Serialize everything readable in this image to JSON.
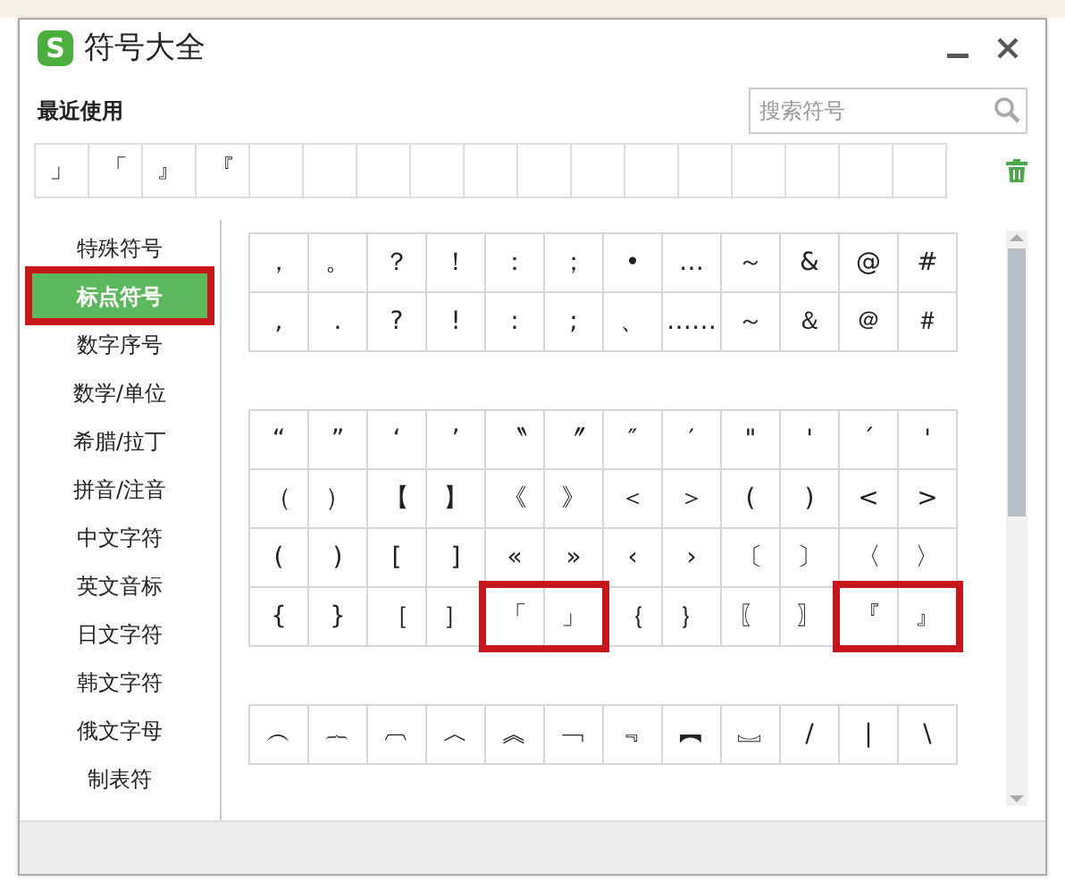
{
  "window": {
    "logo": "S",
    "title": "符号大全"
  },
  "recent": {
    "label": "最近使用",
    "symbols": [
      "」",
      "「",
      "』",
      "『"
    ]
  },
  "search": {
    "placeholder": "搜索符号"
  },
  "sidebar": {
    "items": [
      {
        "label": "特殊符号",
        "selected": false,
        "marked": false
      },
      {
        "label": "标点符号",
        "selected": true,
        "marked": true
      },
      {
        "label": "数字序号",
        "selected": false,
        "marked": false
      },
      {
        "label": "数学/单位",
        "selected": false,
        "marked": false
      },
      {
        "label": "希腊/拉丁",
        "selected": false,
        "marked": false
      },
      {
        "label": "拼音/注音",
        "selected": false,
        "marked": false
      },
      {
        "label": "中文字符",
        "selected": false,
        "marked": false
      },
      {
        "label": "英文音标",
        "selected": false,
        "marked": false
      },
      {
        "label": "日文字符",
        "selected": false,
        "marked": false
      },
      {
        "label": "韩文字符",
        "selected": false,
        "marked": false
      },
      {
        "label": "俄文字母",
        "selected": false,
        "marked": false
      },
      {
        "label": "制表符",
        "selected": false,
        "marked": false
      }
    ]
  },
  "groups": [
    {
      "rows": [
        {
          "cells": [
            "，",
            "。",
            "？",
            "！",
            "：",
            "；",
            "•",
            "…",
            "～",
            "&",
            "@",
            "#"
          ],
          "marked": [
            false,
            false,
            false,
            false,
            false,
            false,
            false,
            false,
            false,
            false,
            false,
            false
          ]
        },
        {
          "cells": [
            ",",
            ".",
            "?",
            "!",
            ":",
            ";",
            "、",
            "……",
            "～",
            "＆",
            "＠",
            "＃"
          ],
          "marked": [
            false,
            false,
            false,
            false,
            false,
            false,
            false,
            false,
            false,
            false,
            false,
            false
          ]
        }
      ]
    },
    {
      "rows": [
        {
          "cells": [
            "“",
            "”",
            "‘",
            "’",
            "〝",
            "〞",
            "″",
            "′",
            "\"",
            "'",
            "´",
            "'"
          ],
          "marked": [
            false,
            false,
            false,
            false,
            false,
            false,
            false,
            false,
            false,
            false,
            false,
            false
          ]
        },
        {
          "cells": [
            "（",
            "）",
            "【",
            "】",
            "《",
            "》",
            "＜",
            "＞",
            "(",
            ")",
            "<",
            ">"
          ],
          "marked": [
            false,
            false,
            false,
            false,
            false,
            false,
            false,
            false,
            false,
            false,
            false,
            false
          ]
        },
        {
          "cells": [
            "(",
            ")",
            "[",
            "]",
            "«",
            "»",
            "‹",
            "›",
            "〔",
            "〕",
            "〈",
            "〉"
          ],
          "marked": [
            false,
            false,
            false,
            false,
            false,
            false,
            false,
            false,
            false,
            false,
            false,
            false
          ]
        },
        {
          "cells": [
            "{",
            "}",
            "［",
            "］",
            "「",
            "」",
            "｛",
            "｝",
            "〖",
            "〗",
            "『",
            "』"
          ],
          "marked": [
            false,
            false,
            false,
            false,
            true,
            true,
            false,
            false,
            false,
            false,
            true,
            true
          ]
        }
      ]
    },
    {
      "rows": [
        {
          "cells": [
            "︵",
            "︷",
            "︹",
            "︿",
            "︽",
            "﹁",
            "﹃",
            "︻",
            "︗",
            "/",
            "|",
            "\\"
          ],
          "marked": [
            false,
            false,
            false,
            false,
            false,
            false,
            false,
            false,
            false,
            false,
            false,
            false
          ]
        }
      ]
    }
  ]
}
